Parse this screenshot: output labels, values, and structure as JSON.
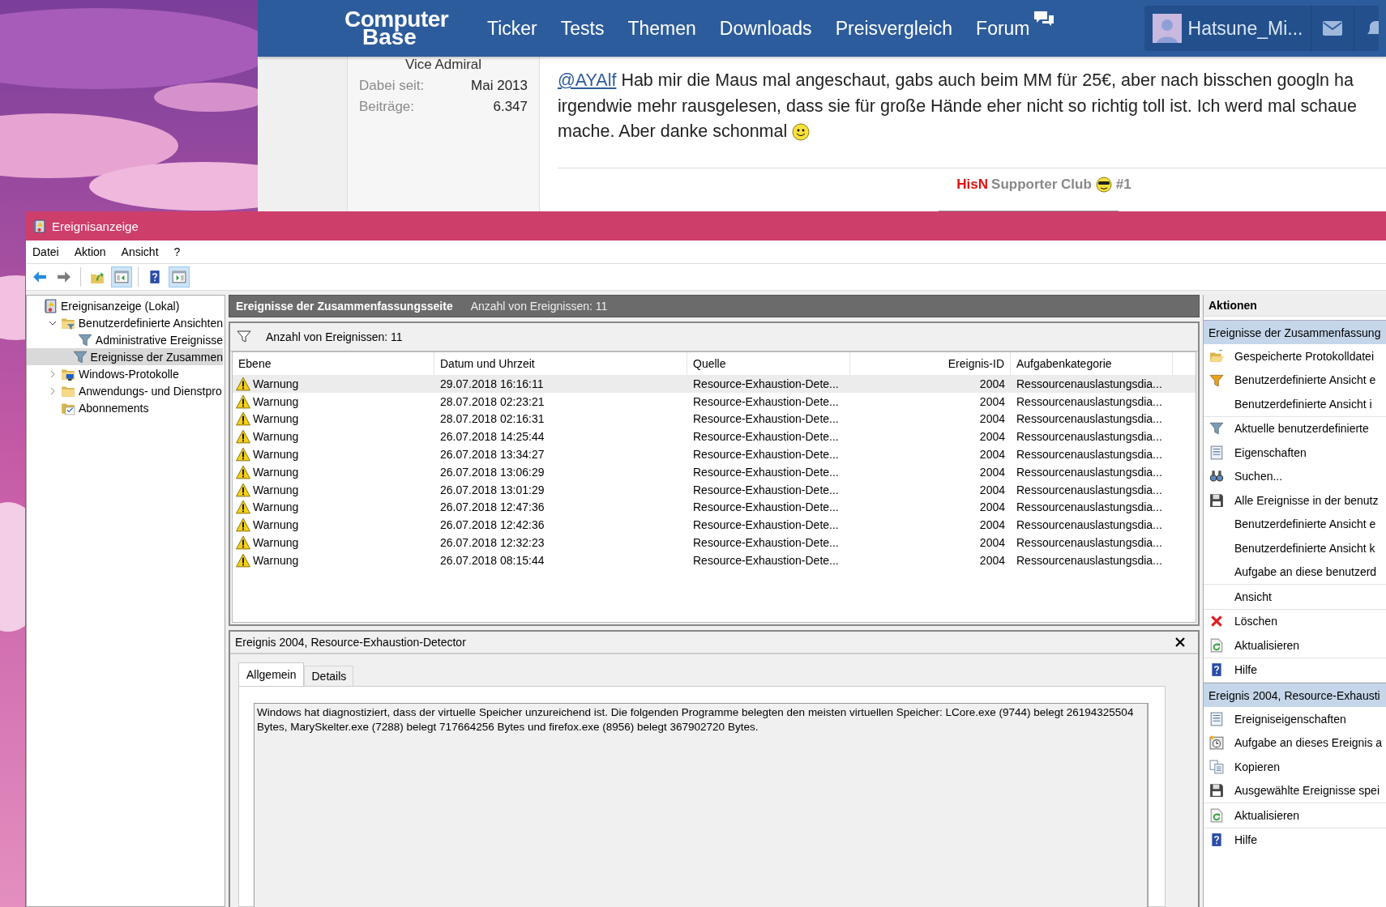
{
  "browser": {
    "logo": {
      "line_1": "Computer",
      "line_2": "Base"
    },
    "nav": [
      {
        "label": "Ticker"
      },
      {
        "label": "Tests"
      },
      {
        "label": "Themen"
      },
      {
        "label": "Downloads"
      },
      {
        "label": "Preisvergleich"
      },
      {
        "label": "Forum"
      }
    ],
    "user": {
      "name": "Hatsune_Mi..."
    },
    "author": {
      "rank": "Vice Admiral",
      "stats": [
        {
          "label": "Dabei seit:",
          "value": "Mai 2013"
        },
        {
          "label": "Beiträge:",
          "value": "6.347"
        }
      ]
    },
    "post": {
      "mention": "@AYAlf",
      "lines": [
        "Hab mir die Maus mal angeschaut, gabs auch beim MM für 25€, aber nach bisschen googln ha",
        "irgendwie mehr rausgelesen, dass sie für große Hände eher nicht so richtig toll ist. Ich werd mal schaue",
        "mache. Aber danke schonmal"
      ],
      "signature": {
        "name": "HisN",
        "club": "Supporter Club",
        "number": "#1"
      }
    }
  },
  "window": {
    "title": "Ereignisanzeige",
    "menu": [
      "Datei",
      "Aktion",
      "Ansicht",
      "?"
    ],
    "toolbar": [
      {
        "kind": "back",
        "pressed": false
      },
      {
        "kind": "forward",
        "pressed": false
      },
      {
        "kind": "up",
        "pressed": false
      },
      {
        "kind": "tree",
        "pressed": true
      },
      {
        "kind": "help",
        "pressed": false
      },
      {
        "kind": "actions",
        "pressed": true
      }
    ],
    "tree": [
      {
        "label": "Ereignisanzeige (Lokal)",
        "kind": "log",
        "selected": false,
        "expanded": true,
        "children": [
          {
            "label": "Benutzerdefinierte Ansichten",
            "kind": "filter-folder",
            "selected": false,
            "expanded": true,
            "children": [
              {
                "label": "Administrative Ereignisse",
                "kind": "filter",
                "selected": false
              },
              {
                "label": "Ereignisse der Zusammen",
                "kind": "filter",
                "selected": true
              }
            ]
          },
          {
            "label": "Windows-Protokolle",
            "kind": "computer-folder",
            "selected": false,
            "expanded": false
          },
          {
            "label": "Anwendungs- und Dienstpro",
            "kind": "folder",
            "selected": false,
            "expanded": false
          },
          {
            "label": "Abonnements",
            "kind": "subscription",
            "selected": false
          }
        ]
      }
    ],
    "summary": {
      "title": "Ereignisse der Zusammenfassungsseite",
      "count": "Anzahl von Ereignissen: 11",
      "filter": "Anzahl von Ereignissen: 11"
    },
    "table": {
      "columns": [
        "Ebene",
        "Datum und Uhrzeit",
        "Quelle",
        "Ereignis-ID",
        "Aufgabenkategorie"
      ],
      "rows": [
        {
          "level": "Warnung",
          "date": "29.07.2018 16:16:11",
          "source": "Resource-Exhaustion-Dete...",
          "id": "2004",
          "category": "Ressourcenauslastungsdia...",
          "selected": true
        },
        {
          "level": "Warnung",
          "date": "28.07.2018 02:23:21",
          "source": "Resource-Exhaustion-Dete...",
          "id": "2004",
          "category": "Ressourcenauslastungsdia...",
          "selected": false
        },
        {
          "level": "Warnung",
          "date": "28.07.2018 02:16:31",
          "source": "Resource-Exhaustion-Dete...",
          "id": "2004",
          "category": "Ressourcenauslastungsdia...",
          "selected": false
        },
        {
          "level": "Warnung",
          "date": "26.07.2018 14:25:44",
          "source": "Resource-Exhaustion-Dete...",
          "id": "2004",
          "category": "Ressourcenauslastungsdia...",
          "selected": false
        },
        {
          "level": "Warnung",
          "date": "26.07.2018 13:34:27",
          "source": "Resource-Exhaustion-Dete...",
          "id": "2004",
          "category": "Ressourcenauslastungsdia...",
          "selected": false
        },
        {
          "level": "Warnung",
          "date": "26.07.2018 13:06:29",
          "source": "Resource-Exhaustion-Dete...",
          "id": "2004",
          "category": "Ressourcenauslastungsdia...",
          "selected": false
        },
        {
          "level": "Warnung",
          "date": "26.07.2018 13:01:29",
          "source": "Resource-Exhaustion-Dete...",
          "id": "2004",
          "category": "Ressourcenauslastungsdia...",
          "selected": false
        },
        {
          "level": "Warnung",
          "date": "26.07.2018 12:47:36",
          "source": "Resource-Exhaustion-Dete...",
          "id": "2004",
          "category": "Ressourcenauslastungsdia...",
          "selected": false
        },
        {
          "level": "Warnung",
          "date": "26.07.2018 12:42:36",
          "source": "Resource-Exhaustion-Dete...",
          "id": "2004",
          "category": "Ressourcenauslastungsdia...",
          "selected": false
        },
        {
          "level": "Warnung",
          "date": "26.07.2018 12:32:23",
          "source": "Resource-Exhaustion-Dete...",
          "id": "2004",
          "category": "Ressourcenauslastungsdia...",
          "selected": false
        },
        {
          "level": "Warnung",
          "date": "26.07.2018 08:15:44",
          "source": "Resource-Exhaustion-Dete...",
          "id": "2004",
          "category": "Ressourcenauslastungsdia...",
          "selected": false
        }
      ]
    },
    "detail": {
      "title": "Ereignis 2004, Resource-Exhaustion-Detector",
      "tabs": [
        {
          "label": "Allgemein",
          "selected": true
        },
        {
          "label": "Details",
          "selected": false
        }
      ],
      "description": "Windows hat diagnostiziert, dass der virtuelle Speicher unzureichend ist. Die folgenden Programme belegten den meisten virtuellen Speicher: LCore.exe (9744) belegt 26194325504 Bytes, MarySkelter.exe (7288) belegt 717664256 Bytes und firefox.exe (8956) belegt 367902720 Bytes."
    },
    "actions": {
      "title": "Aktionen",
      "sections": [
        {
          "title": "Ereignisse der Zusammenfassung",
          "groups": [
            [
              {
                "label": "Gespeicherte Protokolldatei",
                "kind": "open"
              },
              {
                "label": "Benutzerdefinierte Ansicht e",
                "kind": "filter-new"
              },
              {
                "label": "Benutzerdefinierte Ansicht i",
                "kind": "none"
              }
            ],
            [
              {
                "label": "Aktuelle benutzerdefinierte",
                "kind": "filter"
              },
              {
                "label": "Eigenschaften",
                "kind": "properties"
              },
              {
                "label": "Suchen...",
                "kind": "find"
              },
              {
                "label": "Alle Ereignisse in der benutz",
                "kind": "save"
              },
              {
                "label": "Benutzerdefinierte Ansicht e",
                "kind": "none"
              },
              {
                "label": "Benutzerdefinierte Ansicht k",
                "kind": "none"
              },
              {
                "label": "Aufgabe an diese benutzerd",
                "kind": "none"
              }
            ],
            [
              {
                "label": "Ansicht",
                "kind": "none"
              }
            ],
            [
              {
                "label": "Löschen",
                "kind": "delete"
              },
              {
                "label": "Aktualisieren",
                "kind": "refresh"
              }
            ],
            [
              {
                "label": "Hilfe",
                "kind": "help"
              }
            ]
          ]
        },
        {
          "title": "Ereignis 2004, Resource-Exhausti",
          "groups": [
            [
              {
                "label": "Ereigniseigenschaften",
                "kind": "properties"
              },
              {
                "label": "Aufgabe an dieses Ereignis a",
                "kind": "task"
              },
              {
                "label": "Kopieren",
                "kind": "copy"
              },
              {
                "label": "Ausgewählte Ereignisse spei",
                "kind": "save"
              }
            ],
            [
              {
                "label": "Aktualisieren",
                "kind": "refresh"
              }
            ],
            [
              {
                "label": "Hilfe",
                "kind": "help"
              }
            ]
          ]
        }
      ]
    }
  }
}
